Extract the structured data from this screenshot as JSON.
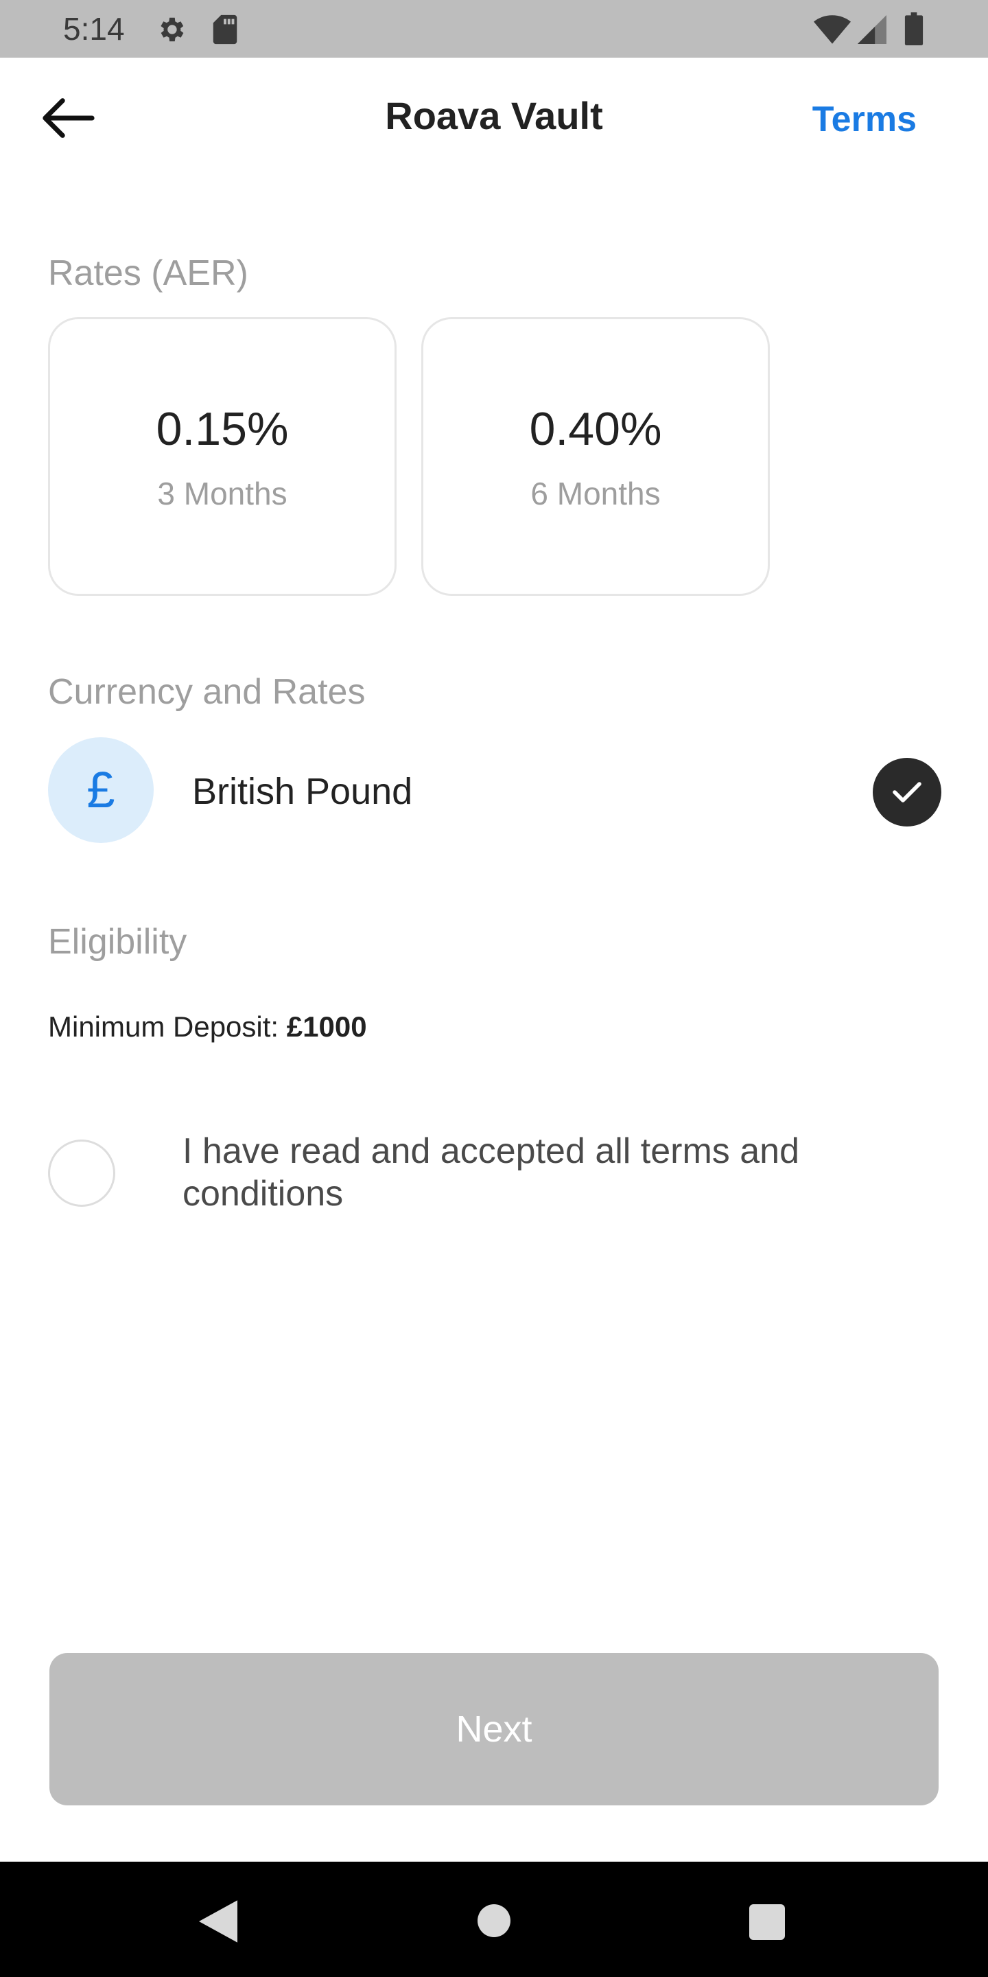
{
  "status_bar": {
    "time": "5:14",
    "icons": [
      "gear-icon",
      "sd-card-icon",
      "wifi-icon",
      "signal-icon",
      "battery-icon"
    ]
  },
  "header": {
    "title": "Roava Vault",
    "terms_label": "Terms",
    "back_icon": "arrow-left-icon"
  },
  "rates": {
    "label": "Rates (AER)",
    "cards": [
      {
        "rate": "0.15%",
        "term": "3 Months"
      },
      {
        "rate": "0.40%",
        "term": "6 Months"
      }
    ]
  },
  "currency": {
    "label": "Currency and Rates",
    "symbol": "£",
    "name": "British Pound",
    "selected": true
  },
  "eligibility": {
    "label": "Eligibility",
    "min_deposit_label": "Minimum Deposit:",
    "min_deposit_value": "£1000"
  },
  "terms_acceptance": {
    "text": "I have read and accepted all terms and conditions",
    "checked": false
  },
  "next_button": {
    "label": "Next",
    "enabled": false
  },
  "colors": {
    "accent": "#1a7be3",
    "status_bar": "#bdbdbd",
    "disabled_button": "#bdbdbd",
    "currency_bg": "#dcedfb"
  }
}
